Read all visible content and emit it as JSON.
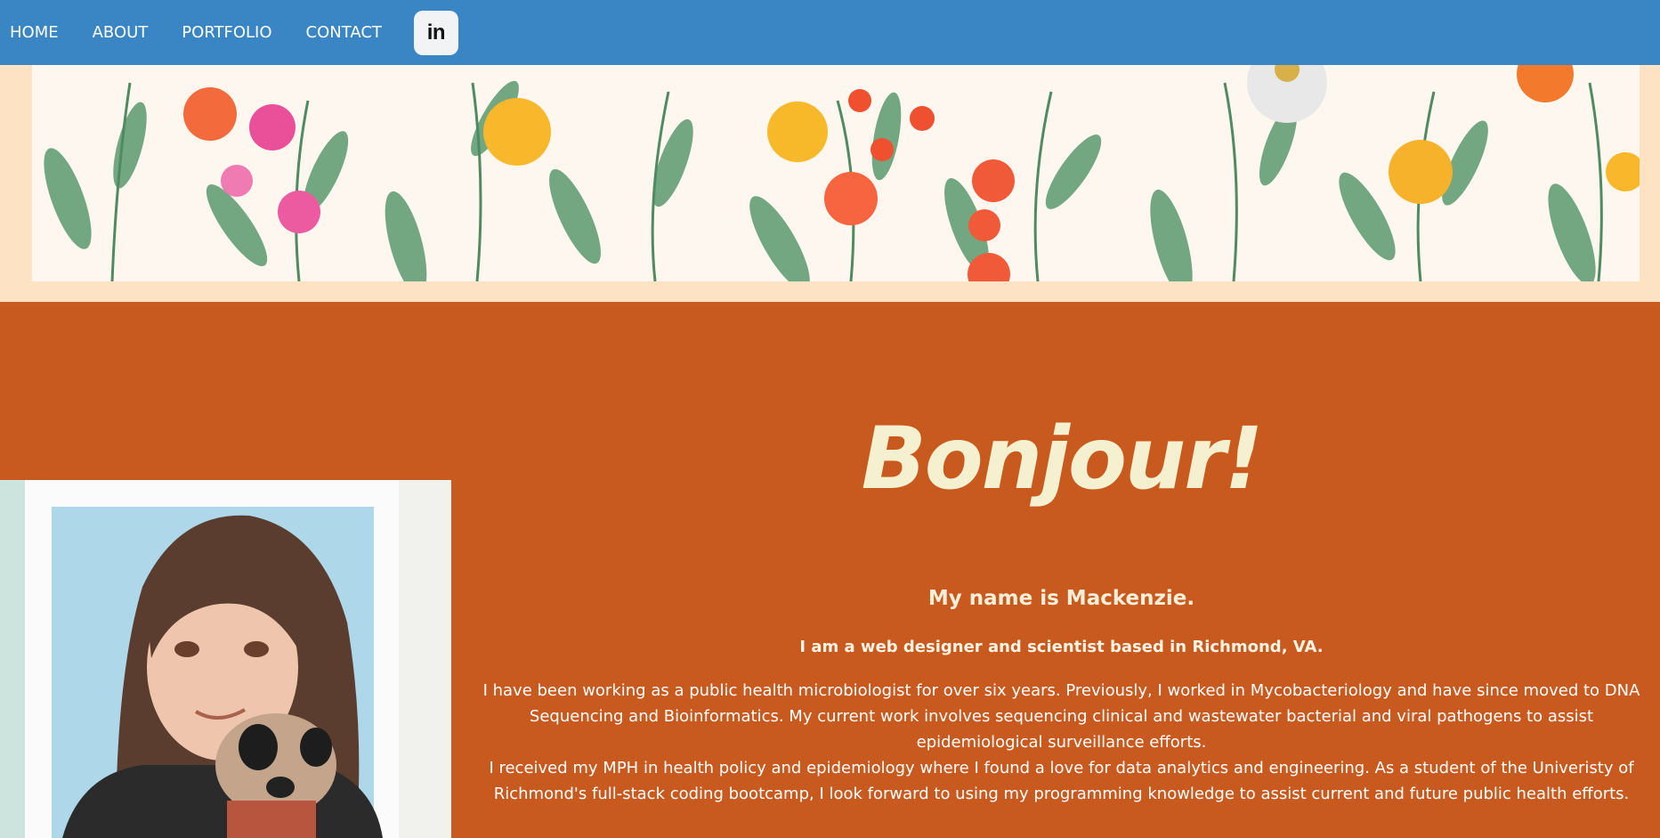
{
  "nav": {
    "items": [
      "HOME",
      "ABOUT",
      "PORTFOLIO",
      "CONTACT"
    ],
    "linkedin_label": "in"
  },
  "colors": {
    "nav_bg": "#3a85c3",
    "banner_frame": "#fde3c3",
    "main_bg": "#c95a1f",
    "greeting": "#f5f0cf"
  },
  "about": {
    "greeting": "Bonjour!",
    "name": "My name is Mackenzie.",
    "tagline": "I am a web designer and scientist based in Richmond, VA.",
    "bio_1": "I have been working as a public health microbiologist for over six years. Previously, I worked in Mycobacteriology and have since moved to DNA Sequencing and Bioinformatics. My current work involves sequencing clinical and wastewater bacterial and viral pathogens to assist epidemiological surveillance efforts.",
    "bio_2": "I received my MPH in health policy and epidemiology where I found a love for data analytics and engineering. As a student of the Univeristy of Richmond's full-stack coding bootcamp, I look forward to using my programming knowledge to assist current and future public health efforts."
  }
}
